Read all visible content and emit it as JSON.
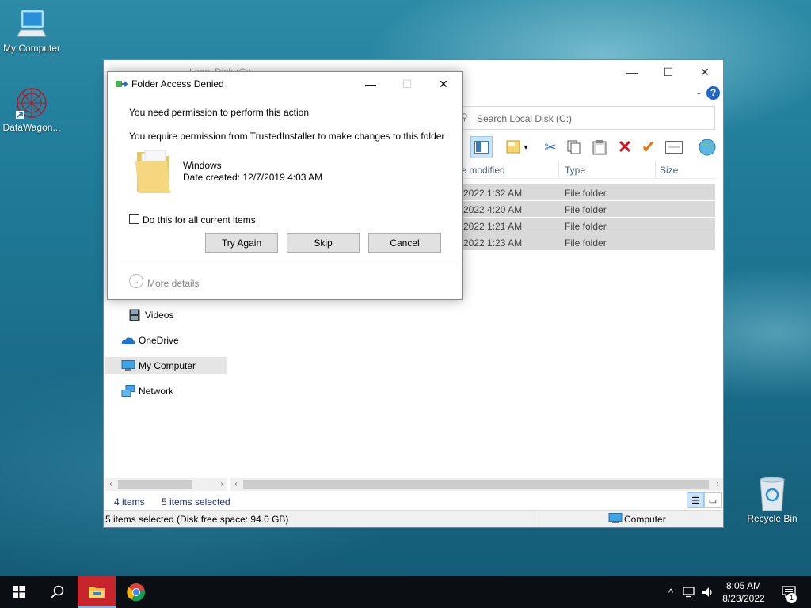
{
  "desktop": {
    "icons": [
      {
        "label": "My Computer"
      },
      {
        "label": "DataWagon..."
      },
      {
        "label": "Recycle Bin"
      }
    ]
  },
  "explorer": {
    "title": "Local Disk (C:)",
    "search_placeholder": "Search Local Disk (C:)",
    "columns": {
      "date": "te modified",
      "type": "Type",
      "size": "Size"
    },
    "rows": [
      {
        "date": "3/2022 1:32 AM",
        "type": "File folder"
      },
      {
        "date": "3/2022 4:20 AM",
        "type": "File folder"
      },
      {
        "date": "3/2022 1:21 AM",
        "type": "File folder"
      },
      {
        "date": "3/2022 1:23 AM",
        "type": "File folder"
      }
    ],
    "nav": {
      "videos": "Videos",
      "onedrive": "OneDrive",
      "my_computer": "My Computer",
      "network": "Network"
    },
    "footer": {
      "items": "4 items",
      "selected": "5 items selected"
    },
    "status": {
      "main": "5 items selected (Disk free space: 94.0 GB)",
      "location": "Computer"
    }
  },
  "dialog": {
    "title": "Folder Access Denied",
    "line1": "You need permission to perform this action",
    "line2": "You require permission from TrustedInstaller to make changes to this folder",
    "folder_name": "Windows",
    "date_created": "Date created: 12/7/2019 4:03 AM",
    "checkbox_label": "Do this for all current items",
    "checkbox_checked": false,
    "buttons": {
      "try_again": "Try Again",
      "skip": "Skip",
      "cancel": "Cancel"
    },
    "more_details": "More details"
  },
  "taskbar": {
    "time": "8:05 AM",
    "date": "8/23/2022",
    "notification_count": "1"
  }
}
